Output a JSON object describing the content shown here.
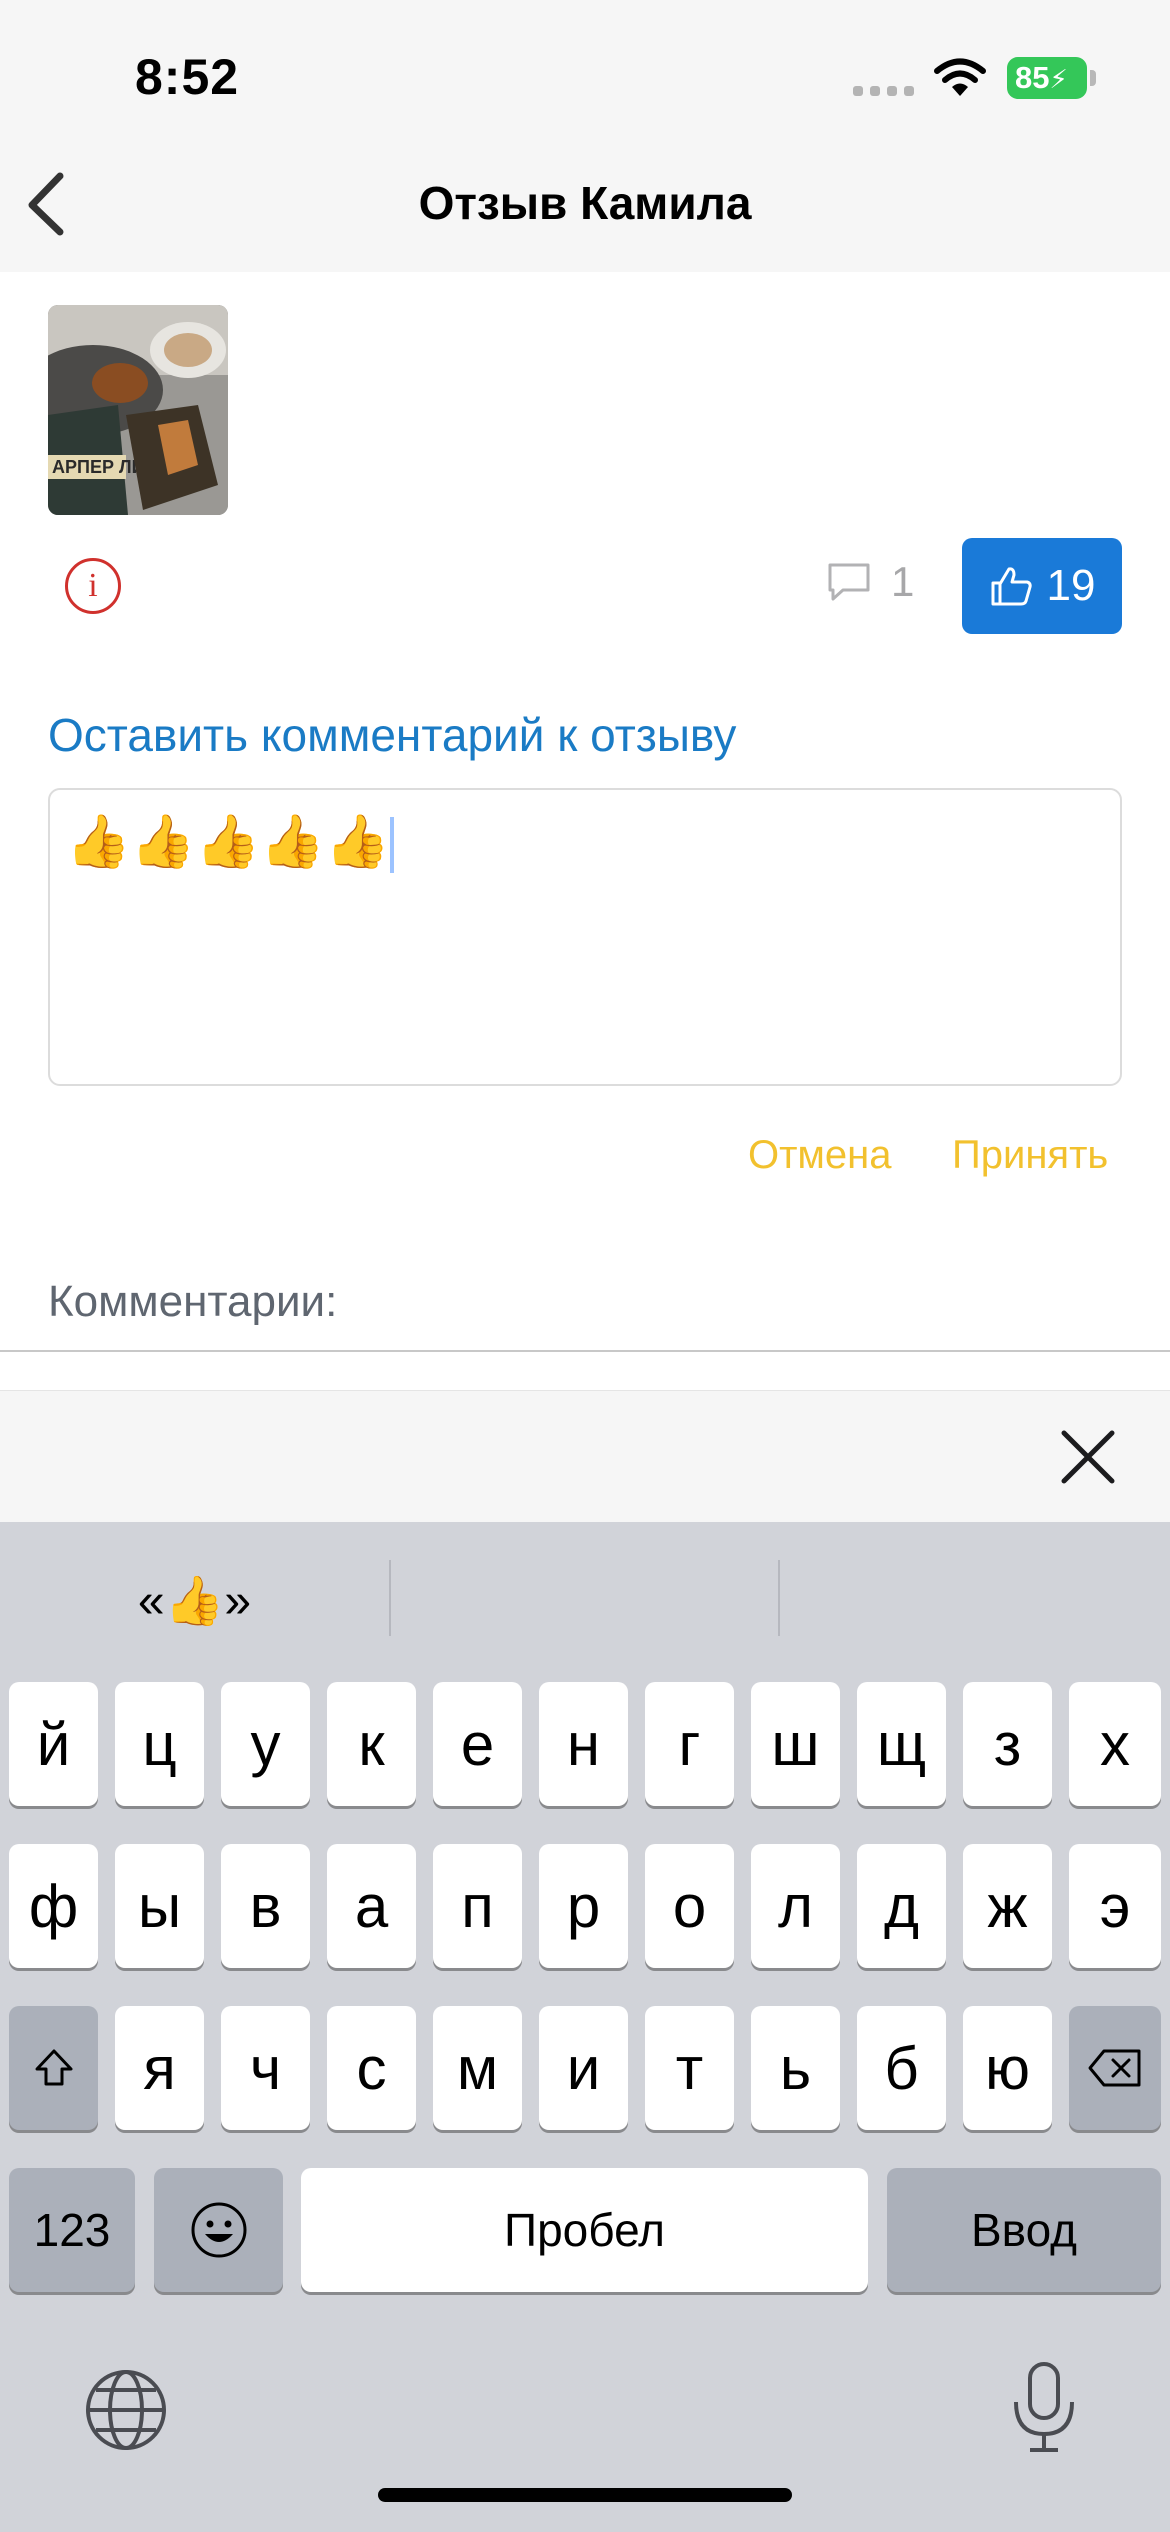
{
  "status_bar": {
    "time": "8:52",
    "battery": "85"
  },
  "nav": {
    "title": "Отзыв Камила"
  },
  "review": {
    "comments_count": "1",
    "likes_count": "19"
  },
  "comment_form": {
    "heading": "Оставить комментарий к отзыву",
    "value": "👍👍👍👍👍",
    "cancel_label": "Отмена",
    "accept_label": "Принять"
  },
  "comments_section": {
    "heading": "Комментарии:"
  },
  "keyboard": {
    "suggestions": [
      "«👍»",
      "",
      ""
    ],
    "row1": [
      "й",
      "ц",
      "у",
      "к",
      "е",
      "н",
      "г",
      "ш",
      "щ",
      "з",
      "х"
    ],
    "row2": [
      "ф",
      "ы",
      "в",
      "а",
      "п",
      "р",
      "о",
      "л",
      "д",
      "ж",
      "э"
    ],
    "row3": [
      "я",
      "ч",
      "с",
      "м",
      "и",
      "т",
      "ь",
      "б",
      "ю"
    ],
    "numbers_label": "123",
    "space_label": "Пробел",
    "return_label": "Ввод"
  },
  "colors": {
    "accent_blue": "#1a7ad8",
    "link_blue": "#1a7bc5",
    "action_yellow": "#f2c12e",
    "info_red": "#d0312d"
  }
}
